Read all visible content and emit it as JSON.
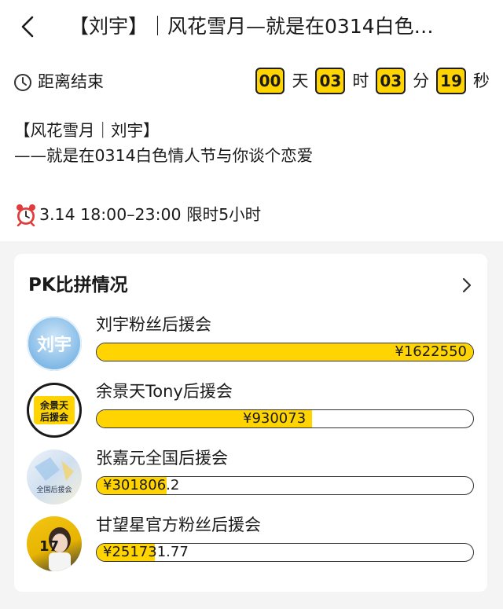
{
  "header": {
    "title": "【刘宇】｜风花雪月—就是在0314白色…"
  },
  "countdown": {
    "label": "距离结束",
    "days": "00",
    "days_unit": "天",
    "hours": "03",
    "hours_unit": "时",
    "minutes": "03",
    "minutes_unit": "分",
    "seconds": "19",
    "seconds_unit": "秒"
  },
  "description": {
    "line1": "【风花雪月｜刘宇】",
    "line2": "——就是在0314白色情人节与你谈个恋爱"
  },
  "event": {
    "time_text": "3.14 18:00–23:00 限时5小时"
  },
  "pk": {
    "title": "PK比拼情况",
    "rows": [
      {
        "name": "刘宇粉丝后援会",
        "amount": "¥1622550",
        "progress": 1.0,
        "avatar_text": "刘宇"
      },
      {
        "name": "余景天Tony后援会",
        "amount": "¥930073",
        "progress": 0.573,
        "avatar_text_1": "余景天",
        "avatar_text_2": "后援会"
      },
      {
        "name": "张嘉元全国后援会",
        "amount": "¥301806.2",
        "progress": 0.186,
        "avatar_text": "全国后援会"
      },
      {
        "name": "甘望星官方粉丝后援会",
        "amount": "¥251731.77",
        "progress": 0.155,
        "avatar_text": "17"
      }
    ]
  },
  "colors": {
    "accent": "#ffd400",
    "page_bg": "#f4f4f4"
  },
  "icons": {
    "back": "chevron-left-icon",
    "clock": "clock-icon",
    "alarm": "alarm-clock-icon",
    "more": "chevron-right-icon"
  }
}
